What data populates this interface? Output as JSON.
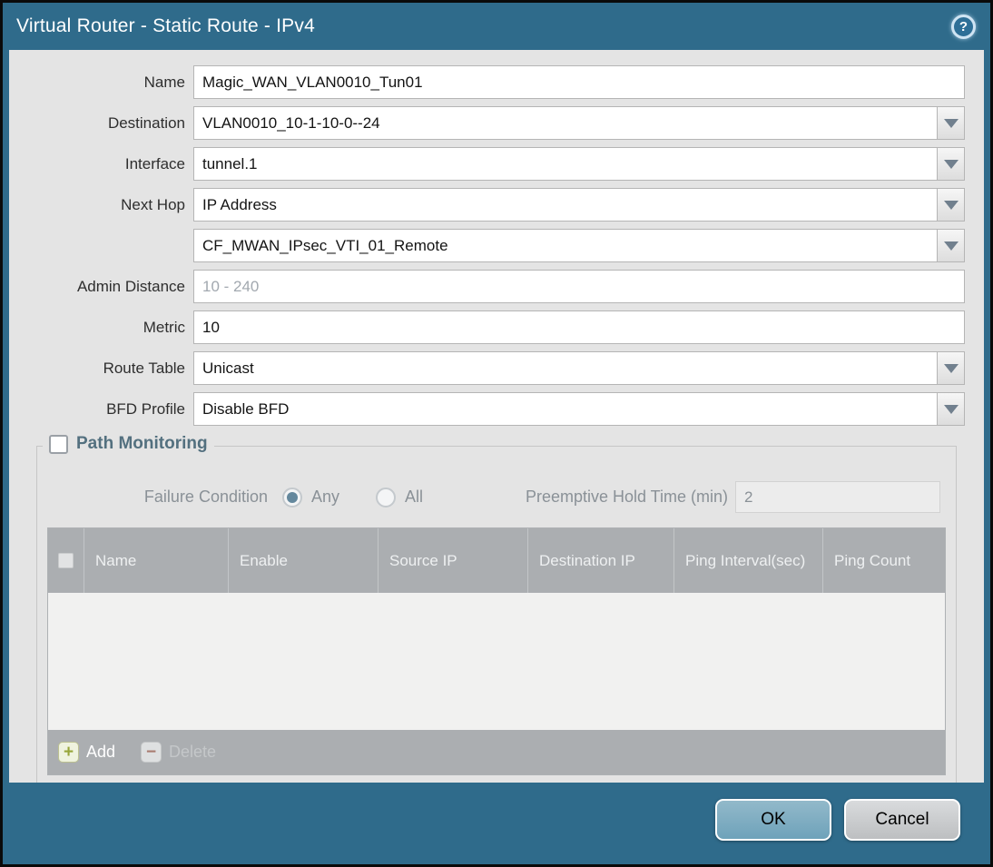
{
  "titlebar": {
    "title": "Virtual Router - Static Route - IPv4",
    "help_glyph": "?"
  },
  "form": {
    "rows": [
      {
        "label": "Name",
        "value": "Magic_WAN_VLAN0010_Tun01"
      },
      {
        "label": "Destination",
        "value": "VLAN0010_10-1-10-0--24"
      },
      {
        "label": "Interface",
        "value": "tunnel.1"
      },
      {
        "label": "Next Hop",
        "value": "IP Address"
      },
      {
        "label": "",
        "value": "CF_MWAN_IPsec_VTI_01_Remote"
      },
      {
        "label": "Admin Distance",
        "placeholder": "10 - 240"
      },
      {
        "label": "Metric",
        "value": "10"
      },
      {
        "label": "Route Table",
        "value": "Unicast"
      },
      {
        "label": "BFD Profile",
        "value": "Disable BFD"
      }
    ]
  },
  "path_monitoring": {
    "legend": "Path Monitoring",
    "failure_condition": {
      "label": "Failure Condition",
      "option_any": "Any",
      "option_all": "All",
      "selected": "Any"
    },
    "preemptive": {
      "label": "Preemptive Hold Time (min)",
      "value": "2"
    },
    "table": {
      "columns": [
        "Name",
        "Enable",
        "Source IP",
        "Destination IP",
        "Ping Interval(sec)",
        "Ping Count"
      ]
    },
    "toolbar": {
      "add_label": "Add",
      "delete_label": "Delete",
      "add_glyph": "+",
      "delete_glyph": "−"
    }
  },
  "footer": {
    "ok_label": "OK",
    "cancel_label": "Cancel"
  },
  "colors": {
    "frame_teal": "#2f6b8b",
    "body_gray": "#e4e4e4",
    "header_gray": "#abaeb1",
    "ok_blue": "#6ea2ba",
    "legend_steel": "#53707f"
  }
}
